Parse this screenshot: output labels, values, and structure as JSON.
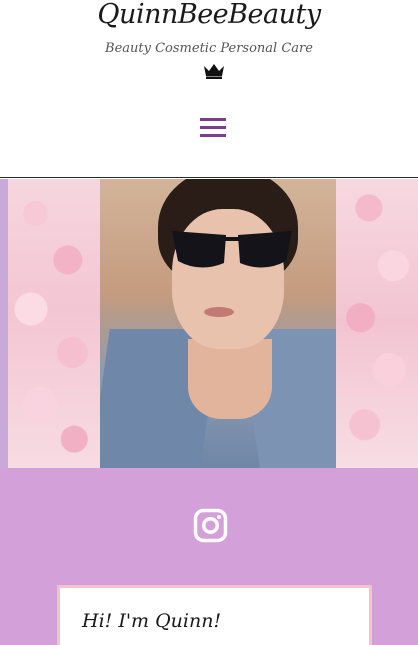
{
  "site": {
    "title": "QuinnBeeBeauty",
    "tagline": "Beauty Cosmetic Personal Care"
  },
  "icons": {
    "logo": "crown-icon",
    "menu": "hamburger-menu-icon",
    "social": "instagram-icon"
  },
  "colors": {
    "accent": "#7a3f8c",
    "lower_background": "#d3a0d9",
    "card_border": "#f1c2cf"
  },
  "intro": {
    "heading": "Hi! I'm Quinn!"
  }
}
